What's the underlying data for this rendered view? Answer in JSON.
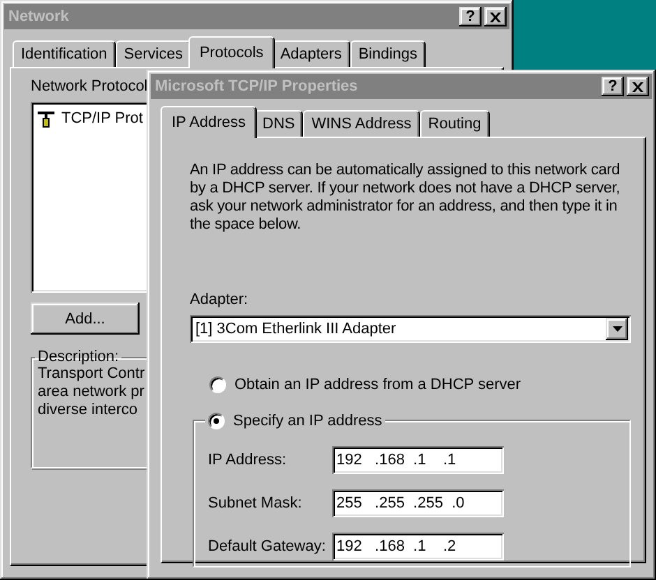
{
  "network_window": {
    "title": "Network",
    "help_button": "?",
    "tabs": [
      {
        "label": "Identification",
        "selected": false
      },
      {
        "label": "Services",
        "selected": false
      },
      {
        "label": "Protocols",
        "selected": true
      },
      {
        "label": "Adapters",
        "selected": false
      },
      {
        "label": "Bindings",
        "selected": false
      }
    ],
    "protocols_label": "Network Protocol",
    "protocols": [
      "TCP/IP Prot"
    ],
    "add_button": "Add...",
    "description": {
      "title": "Description:",
      "lines": [
        "Transport Contr",
        "area network pr",
        "diverse interco"
      ]
    }
  },
  "tcpip_window": {
    "title": "Microsoft TCP/IP Properties",
    "help_button": "?",
    "tabs": [
      {
        "label": "IP Address",
        "selected": true
      },
      {
        "label": "DNS",
        "selected": false
      },
      {
        "label": "WINS Address",
        "selected": false
      },
      {
        "label": "Routing",
        "selected": false
      }
    ],
    "intro_lines": [
      "An IP address can be automatically assigned to this network card",
      "by a DHCP server.  If your network does not have a DHCP server,",
      "ask your network administrator for an address, and then type it in",
      "the space below."
    ],
    "adapter_label": "Adapter:",
    "adapter": "[1] 3Com Etherlink III Adapter",
    "options": [
      {
        "label": "Obtain an IP address from a DHCP server",
        "selected": false
      },
      {
        "label": "Specify an IP address",
        "selected": true
      }
    ],
    "fields": [
      {
        "label": "IP Address:",
        "value": [
          "192",
          ".168",
          ".1",
          ".1"
        ]
      },
      {
        "label": "Subnet Mask:",
        "value": [
          "255",
          ".255",
          ".255",
          ".0"
        ]
      },
      {
        "label": "Default Gateway:",
        "value": [
          "192",
          ".168",
          ".1",
          ".2"
        ]
      }
    ]
  }
}
